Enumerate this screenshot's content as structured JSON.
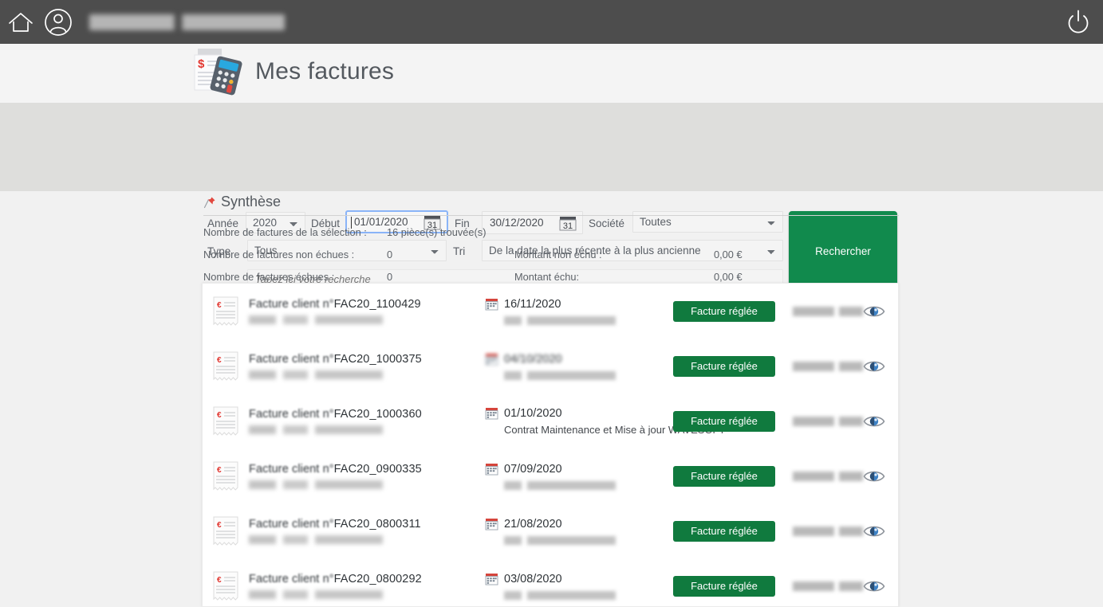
{
  "topbar": {
    "home_icon": "home-icon",
    "user_icon": "user-avatar-icon",
    "username": "",
    "power_icon": "power-logout-icon"
  },
  "page": {
    "title": "Mes factures",
    "title_icon": "invoice-calculator-icon"
  },
  "filters": {
    "annee_label": "Année",
    "annee_value": "2020",
    "annee_options": [
      "2020"
    ],
    "debut_label": "Début",
    "debut_value": "01/01/2020",
    "fin_label": "Fin",
    "fin_value": "30/12/2020",
    "societe_label": "Société",
    "societe_value": "Toutes",
    "societe_options": [
      "Toutes"
    ],
    "type_label": "Type",
    "type_value": "Tous",
    "type_options": [
      "Tous"
    ],
    "tri_label": "Tri",
    "tri_value": "De la date la plus récente à la plus ancienne",
    "tri_options": [
      "De la date la plus récente à la plus ancienne"
    ],
    "search_placeholder": "Tapez ici votre recherche",
    "search_value": "",
    "search_button": "Rechercher",
    "calendar_icon": "calendar-picker-icon",
    "button_color": "#118a4d"
  },
  "synthese": {
    "title": "Synthèse",
    "pin_icon": "pushpin-icon",
    "rows": [
      {
        "label": "Nombre de factures de la sélection :",
        "value": "16 pièce(s) trouvée(s)",
        "label2": "",
        "value2": ""
      },
      {
        "label": "Nombre de factures non échues :",
        "value": "0",
        "label2": "Montant non échu :",
        "value2": "0,00 €"
      },
      {
        "label": "Nombre de factures échues :",
        "value": "0",
        "label2": "Montant échu:",
        "value2": "0,00 €"
      }
    ]
  },
  "invoices": {
    "badge_color": "#107a3e",
    "doc_icon": "invoice-document-icon",
    "date_icon": "calendar-icon",
    "view_icon": "eye-view-icon",
    "pdf_icon": "pdf-download-icon",
    "rows": [
      {
        "number_prefix": "Facture client n°",
        "number": "FAC20_1100429",
        "date": "16/11/2020",
        "date_blurred": false,
        "status": "Facture réglée",
        "description": "",
        "description_blurred": true
      },
      {
        "number_prefix": "Facture client n°",
        "number": "FAC20_1000375",
        "date": "04/10/2020",
        "date_blurred": true,
        "status": "Facture réglée",
        "description": "",
        "description_blurred": true
      },
      {
        "number_prefix": "Facture client n°",
        "number": "FAC20_1000360",
        "date": "01/10/2020",
        "date_blurred": false,
        "status": "Facture réglée",
        "description": "Contrat Maintenance et Mise à jour WAVESOFT",
        "description_blurred": false
      },
      {
        "number_prefix": "Facture client n°",
        "number": "FAC20_0900335",
        "date": "07/09/2020",
        "date_blurred": false,
        "status": "Facture réglée",
        "description": "",
        "description_blurred": true
      },
      {
        "number_prefix": "Facture client n°",
        "number": "FAC20_0800311",
        "date": "21/08/2020",
        "date_blurred": false,
        "status": "Facture réglée",
        "description": "",
        "description_blurred": true
      },
      {
        "number_prefix": "Facture client n°",
        "number": "FAC20_0800292",
        "date": "03/08/2020",
        "date_blurred": false,
        "status": "Facture réglée",
        "description": "",
        "description_blurred": true
      }
    ]
  }
}
